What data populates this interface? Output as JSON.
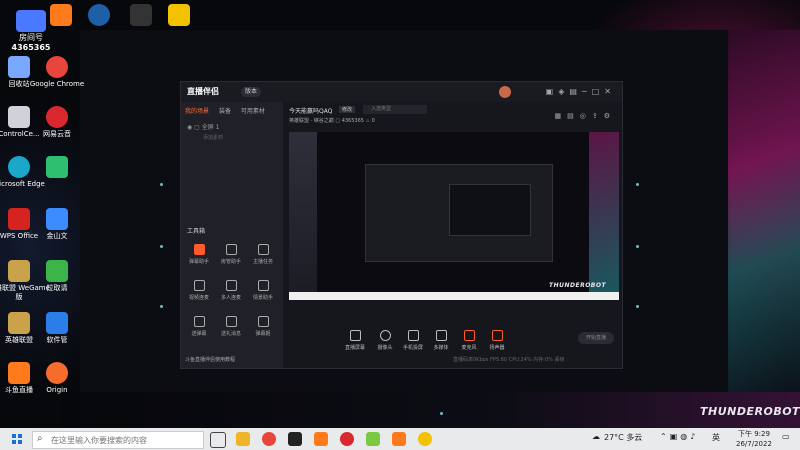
{
  "desktop": {
    "live_badge": {
      "line1": "房间号",
      "line2": "4365365"
    },
    "icons": [
      {
        "label": "回收站",
        "color": "#7aa8ff"
      },
      {
        "label": "Google Chrome",
        "color": "#e8453c"
      },
      {
        "label": "ControlCe...",
        "color": "#cfd2d8"
      },
      {
        "label": "网易云音",
        "color": "#d9282f"
      },
      {
        "label": "Microsoft Edge",
        "color": "#1aa7c9"
      },
      {
        "label": "",
        "color": "#2fbf71"
      },
      {
        "label": "WPS Office",
        "color": "#d5241f"
      },
      {
        "label": "金山文",
        "color": "#3d8cff"
      },
      {
        "label": "英雄联盟 WeGame版",
        "color": "#c9a24a"
      },
      {
        "label": "拉取请",
        "color": "#3bb54a"
      },
      {
        "label": "英雄联盟",
        "color": "#c9a24a"
      },
      {
        "label": "软件管",
        "color": "#2b7de9"
      },
      {
        "label": "斗鱼直播",
        "color": "#ff7a1a"
      },
      {
        "label": "Origin",
        "color": "#f56c2d"
      }
    ],
    "wallpaper_brand": "THUNDEROBOT"
  },
  "app": {
    "title": "直播伴侣",
    "version_label": "版本",
    "sidebar_tabs": [
      "我的场景",
      "装备",
      "可用素材"
    ],
    "scene_name": "全屏 1",
    "scene_hint": "添加素材",
    "tools_heading": "工具箱",
    "tools": [
      {
        "label": "弹幕助手",
        "hot": true
      },
      {
        "label": "房管助手",
        "hot": false
      },
      {
        "label": "主播任务",
        "hot": false
      },
      {
        "label": "视频连麦",
        "hot": false
      },
      {
        "label": "多人连麦",
        "hot": false
      },
      {
        "label": "情景助手",
        "hot": false
      },
      {
        "label": "送弹幕",
        "hot": false
      },
      {
        "label": "送礼消息",
        "hot": false
      },
      {
        "label": "弹幕姬",
        "hot": false
      }
    ],
    "notice": "斗鱼直播伴侣使用教程",
    "room_title": "今天能赢吗QAQ",
    "room_title_button": "修改",
    "room_input_placeholder": "入选类型",
    "room_info": "英雄联盟 · 峡谷之巅",
    "room_id": "4365365",
    "room_count": "0",
    "controls": [
      {
        "label": "直播屏幕"
      },
      {
        "label": "摄像头"
      },
      {
        "label": "手机投屏"
      },
      {
        "label": "多媒体"
      },
      {
        "label": "麦克风"
      },
      {
        "label": "扬声器"
      }
    ],
    "start_live_label": "开始直播",
    "status_text": "直播码率0Kbps    FPS:60    CPU:24%    内存:0%    丢帧"
  },
  "taskbar": {
    "search_placeholder": "在这里输入你要搜索的内容",
    "weather": "27°C 多云",
    "ime": "英",
    "time": "下午 9:29",
    "date": "26/7/2022",
    "apps": [
      {
        "name": "task-view",
        "color": "#444444"
      },
      {
        "name": "file-explorer",
        "color": "#f0b429"
      },
      {
        "name": "chrome",
        "color": "#e8453c"
      },
      {
        "name": "app-g",
        "color": "#222222"
      },
      {
        "name": "douyu",
        "color": "#ff7a1a"
      },
      {
        "name": "netease-music",
        "color": "#d9282f"
      },
      {
        "name": "app-green",
        "color": "#7ac943"
      },
      {
        "name": "douyu-companion",
        "color": "#ff7a1a"
      },
      {
        "name": "app-moon",
        "color": "#f2c200"
      }
    ]
  }
}
